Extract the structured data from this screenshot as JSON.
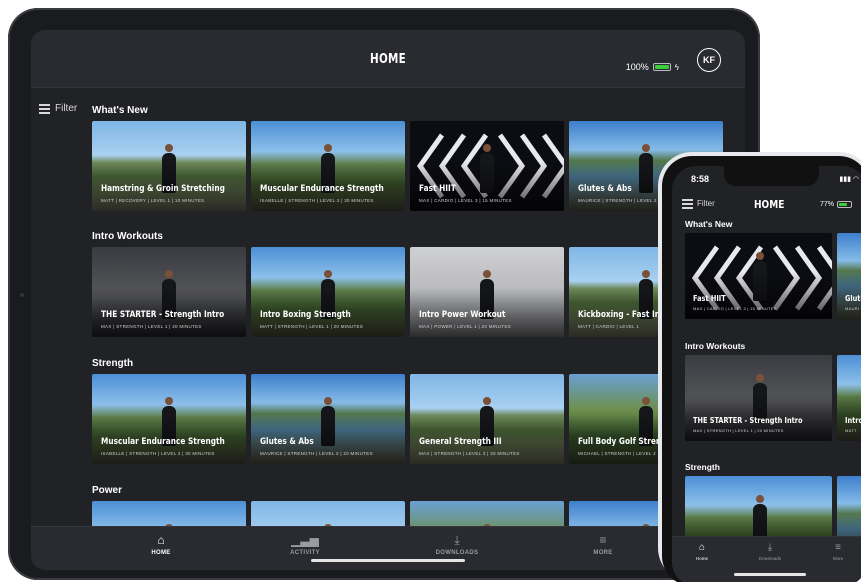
{
  "colors": {
    "background": "#212226",
    "header": "#2a2b30",
    "accent_battery": "#3ccf3c",
    "text": "#ffffff",
    "tab_inactive": "#9a9ba0"
  },
  "ipad": {
    "title": "HOME",
    "battery_percent": "100%",
    "battery_level": 1.0,
    "avatar_initials": "KF",
    "filter_label": "Filter",
    "sections": [
      {
        "title": "What's New",
        "cards": [
          {
            "title": "Hamstring & Groin Stretching",
            "meta": "MATT  |  RECOVERY  |  LEVEL 1  |  10 MINUTES",
            "bg": "bg-mountain"
          },
          {
            "title": "Muscular Endurance Strength",
            "meta": "ISABELLE  |  STRENGTH  |  LEVEL 2  |  30 MINUTES",
            "bg": "bg-valley"
          },
          {
            "title": "Fast HIIT",
            "meta": "MAX  |  CARDIO  |  LEVEL 3  |  15 MINUTES",
            "bg": "bg-chevron"
          },
          {
            "title": "Glutes & Abs",
            "meta": "MAURICE  |  STRENGTH  |  LEVEL 2",
            "bg": "bg-lake"
          }
        ]
      },
      {
        "title": "Intro Workouts",
        "cards": [
          {
            "title": "THE STARTER - Strength Intro",
            "meta": "MAX  |  STRENGTH  |  LEVEL 1  |  20 MINUTES",
            "bg": "bg-studio"
          },
          {
            "title": "Intro Boxing Strength",
            "meta": "MATT  |  STRENGTH  |  LEVEL 1  |  20 MINUTES",
            "bg": "bg-valley"
          },
          {
            "title": "Intro Power Workout",
            "meta": "MAX  |  POWER  |  LEVEL 1  |  20 MINUTES",
            "bg": "bg-white-room"
          },
          {
            "title": "Kickboxing - Fast Intro",
            "meta": "MATT  |  CARDIO  |  LEVEL 1",
            "bg": "bg-mountain"
          }
        ]
      },
      {
        "title": "Strength",
        "cards": [
          {
            "title": "Muscular Endurance Strength",
            "meta": "ISABELLE  |  STRENGTH  |  LEVEL 2  |  30 MINUTES",
            "bg": "bg-valley"
          },
          {
            "title": "Glutes & Abs",
            "meta": "MAURICE  |  STRENGTH  |  LEVEL 2  |  20 MINUTES",
            "bg": "bg-lake"
          },
          {
            "title": "General Strength III",
            "meta": "MAX  |  STRENGTH  |  LEVEL 3  |  20 MINUTES",
            "bg": "bg-mountain"
          },
          {
            "title": "Full Body Golf Strength",
            "meta": "MICHAEL  |  STRENGTH  |  LEVEL 2",
            "bg": "bg-forest"
          }
        ]
      },
      {
        "title": "Power",
        "cards": [
          {
            "title": "",
            "meta": "",
            "bg": "bg-valley"
          },
          {
            "title": "",
            "meta": "",
            "bg": "bg-mountain"
          },
          {
            "title": "",
            "meta": "",
            "bg": "bg-forest"
          },
          {
            "title": "",
            "meta": "",
            "bg": "bg-lake"
          }
        ]
      }
    ],
    "tabs": [
      {
        "label": "HOME",
        "icon": "home-icon",
        "glyph": "⌂",
        "active": true
      },
      {
        "label": "ACTIVITY",
        "icon": "activity-icon",
        "glyph": "▁▃▅",
        "active": false
      },
      {
        "label": "DOWNLOADS",
        "icon": "download-icon",
        "glyph": "⤓",
        "active": false
      },
      {
        "label": "MORE",
        "icon": "more-icon",
        "glyph": "≡",
        "active": false
      }
    ]
  },
  "iphone": {
    "time": "8:58",
    "status_icons": "▮▮▮ ◠",
    "filter_label": "Filter",
    "title": "HOME",
    "battery_percent": "77%",
    "battery_level": 0.77,
    "sections": [
      {
        "title": "What's New",
        "cards": [
          {
            "title": "Fast HIIT",
            "meta": "MAX  |  CARDIO  |  LEVEL 3  |  15 MINUTES",
            "bg": "bg-chevron"
          },
          {
            "title": "Glute",
            "meta": "MAURI",
            "bg": "bg-lake"
          }
        ]
      },
      {
        "title": "Intro Workouts",
        "cards": [
          {
            "title": "THE STARTER - Strength Intro",
            "meta": "MAX  |  STRENGTH  |  LEVEL 1  |  20 MINUTES",
            "bg": "bg-studio"
          },
          {
            "title": "Intro",
            "meta": "MATT",
            "bg": "bg-valley"
          }
        ]
      },
      {
        "title": "Strength",
        "cards": [
          {
            "title": "",
            "meta": "",
            "bg": "bg-valley"
          },
          {
            "title": "",
            "meta": "",
            "bg": "bg-lake"
          }
        ]
      }
    ],
    "tabs": [
      {
        "label": "Home",
        "icon": "home-icon",
        "glyph": "⌂",
        "active": true
      },
      {
        "label": "Downloads",
        "icon": "download-icon",
        "glyph": "⤓",
        "active": false
      },
      {
        "label": "More",
        "icon": "more-icon",
        "glyph": "≡",
        "active": false
      }
    ]
  }
}
